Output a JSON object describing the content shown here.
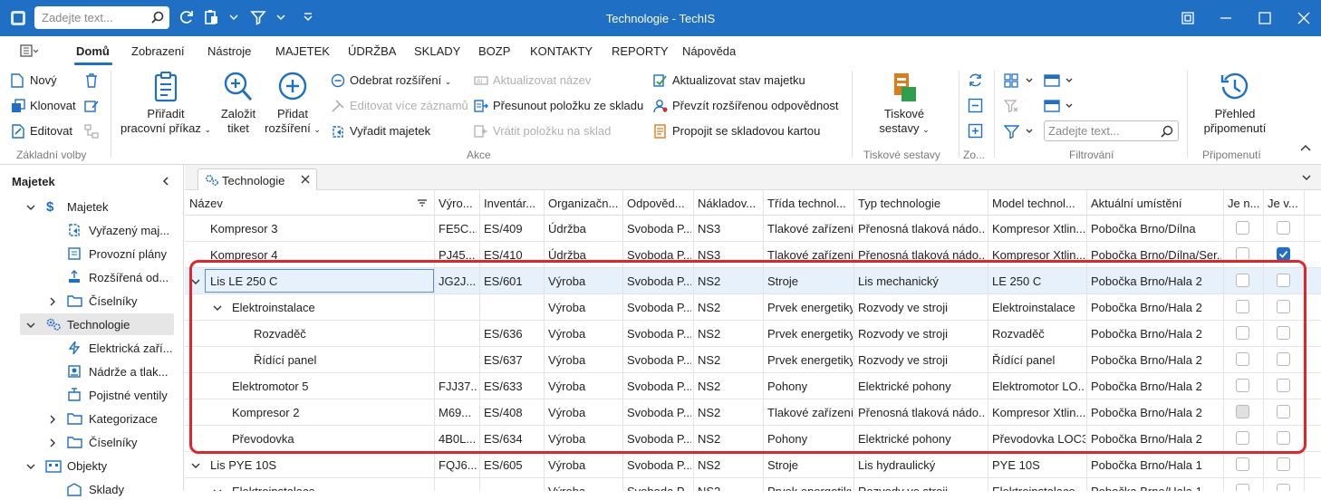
{
  "titlebar": {
    "title": "Technologie - TechIS",
    "search_placeholder": "Zadejte text...",
    "accent": "#1f6fc5"
  },
  "menu": {
    "items": [
      "Domů",
      "Zobrazení",
      "Nástroje",
      "MAJETEK",
      "ÚDRŽBA",
      "SKLADY",
      "BOZP",
      "KONTAKTY",
      "REPORTY",
      "Nápověda"
    ]
  },
  "ribbon": {
    "zakladni": {
      "novy": "Nový",
      "klonovat": "Klonovat",
      "editovat": "Editovat",
      "label": "Základní volby"
    },
    "akce": {
      "prirazeni_1": "Přiřadit",
      "prirazeni_2": "pracovní příkaz",
      "tiket_1": "Založit",
      "tiket_2": "tiket",
      "rozsireni_1": "Přidat",
      "rozsireni_2": "rozšíření",
      "odebrat": "Odebrat rozšíření",
      "editovat_vice": "Editovat více záznamů",
      "vyradit": "Vyřadit majetek",
      "aktualizovat_nazev": "Aktualizovat název",
      "presunout": "Přesunout položku ze skladu",
      "vratit": "Vrátit položku na sklad",
      "aktualizovat_stav": "Aktualizovat stav majetku",
      "prevzit": "Převzít rozšířenou odpovědnost",
      "propojit": "Propojit se skladovou kartou",
      "label": "Akce"
    },
    "tiskove": {
      "btn_1": "Tiskové",
      "btn_2": "sestavy",
      "label": "Tiskové sestavy"
    },
    "zo": {
      "label": "Zo..."
    },
    "filtrovani": {
      "placeholder": "Zadejte text...",
      "label": "Filtrování"
    },
    "pripomenuti": {
      "btn_1": "Přehled",
      "btn_2": "připomenutí",
      "label": "Připomenutí"
    }
  },
  "sidebar": {
    "title": "Majetek",
    "items": [
      {
        "label": "Majetek"
      },
      {
        "label": "Vyřazený maj..."
      },
      {
        "label": "Provozní plány"
      },
      {
        "label": "Rozšířená od..."
      },
      {
        "label": "Číselníky"
      },
      {
        "label": "Technologie"
      },
      {
        "label": "Elektrická zaří..."
      },
      {
        "label": "Nádrže a tlak..."
      },
      {
        "label": "Pojistné ventily"
      },
      {
        "label": "Kategorizace"
      },
      {
        "label": "Číselníky"
      },
      {
        "label": "Objekty"
      },
      {
        "label": "Sklady"
      }
    ]
  },
  "tab": {
    "label": "Technologie"
  },
  "table": {
    "columns": [
      "Název",
      "Výro...",
      "Inventár...",
      "Organizačn...",
      "Odpověd...",
      "Nákladov...",
      "Třída technol...",
      "Typ technologie",
      "Model technol...",
      "Aktuální umístění",
      "Je n...",
      "Je v..."
    ],
    "rows": [
      {
        "name": "Kompresor 3",
        "vyr": "FE5C...",
        "inv": "ES/409",
        "org": "Údržba",
        "odp": "Svoboda P...",
        "nak": "NS3",
        "trida": "Tlakové zařízení",
        "typ": "Přenosná tlaková nádo...",
        "model": "Kompresor Xtlin...",
        "umisteni": "Pobočka Brno/Dílna",
        "jen": false,
        "jev": false
      },
      {
        "name": "Kompresor 4",
        "vyr": "PJ45...",
        "inv": "ES/410",
        "org": "Údržba",
        "odp": "Svoboda P...",
        "nak": "NS3",
        "trida": "Tlakové zařízení",
        "typ": "Přenosná tlaková nádo...",
        "model": "Kompresor Xtlin...",
        "umisteni": "Pobočka Brno/Dílna/Ser...",
        "jen": false,
        "jev": true
      },
      {
        "name": "Lis LE 250 C",
        "vyr": "JG2J...",
        "inv": "ES/601",
        "org": "Výroba",
        "odp": "Svoboda P...",
        "nak": "NS2",
        "trida": "Stroje",
        "typ": "Lis mechanický",
        "model": "LE 250 C",
        "umisteni": "Pobočka Brno/Hala 2",
        "jen": false,
        "jev": false
      },
      {
        "name": "Elektroinstalace",
        "vyr": "",
        "inv": "",
        "org": "Výroba",
        "odp": "Svoboda P...",
        "nak": "NS2",
        "trida": "Prvek energetiky",
        "typ": "Rozvody ve stroji",
        "model": "Elektroinstalace",
        "umisteni": "Pobočka Brno/Hala 2",
        "jen": false,
        "jev": false
      },
      {
        "name": "Rozvaděč",
        "vyr": "",
        "inv": "ES/636",
        "org": "Výroba",
        "odp": "Svoboda P...",
        "nak": "NS2",
        "trida": "Prvek energetiky",
        "typ": "Rozvody ve stroji",
        "model": "Rozvaděč",
        "umisteni": "Pobočka Brno/Hala 2",
        "jen": false,
        "jev": false
      },
      {
        "name": "Řídící panel",
        "vyr": "",
        "inv": "ES/637",
        "org": "Výroba",
        "odp": "Svoboda P...",
        "nak": "NS2",
        "trida": "Prvek energetiky",
        "typ": "Rozvody ve stroji",
        "model": "Řídící panel",
        "umisteni": "Pobočka Brno/Hala 2",
        "jen": false,
        "jev": false
      },
      {
        "name": "Elektromotor 5",
        "vyr": "FJJ37...",
        "inv": "ES/633",
        "org": "Výroba",
        "odp": "Svoboda P...",
        "nak": "NS2",
        "trida": "Pohony",
        "typ": "Elektrické pohony",
        "model": "Elektromotor LO...",
        "umisteni": "Pobočka Brno/Hala 2",
        "jen": false,
        "jev": false
      },
      {
        "name": "Kompresor 2",
        "vyr": "M69...",
        "inv": "ES/408",
        "org": "Výroba",
        "odp": "Svoboda P...",
        "nak": "NS2",
        "trida": "Tlakové zařízení",
        "typ": "Přenosná tlaková nádo...",
        "model": "Kompresor Xtlin...",
        "umisteni": "Pobočka Brno/Hala 2",
        "jen": false,
        "jev": false
      },
      {
        "name": "Převodovka",
        "vyr": "4B0L...",
        "inv": "ES/634",
        "org": "Výroba",
        "odp": "Svoboda P...",
        "nak": "NS2",
        "trida": "Pohony",
        "typ": "Elektrické pohony",
        "model": "Převodovka LOC3...",
        "umisteni": "Pobočka Brno/Hala 2",
        "jen": false,
        "jev": false
      },
      {
        "name": "Lis PYE 10S",
        "vyr": "FQJ6...",
        "inv": "ES/605",
        "org": "Výroba",
        "odp": "Svoboda P...",
        "nak": "NS2",
        "trida": "Stroje",
        "typ": "Lis hydraulický",
        "model": "PYE 10S",
        "umisteni": "Pobočka Brno/Hala 1",
        "jen": false,
        "jev": false
      },
      {
        "name": "Elektroinstalace",
        "vyr": "",
        "inv": "",
        "org": "Výroba",
        "odp": "Svoboda P...",
        "nak": "NS2",
        "trida": "Prvek energetiky",
        "typ": "Rozvody ve stroji",
        "model": "Elektroinstalace",
        "umisteni": "Pobočka Brno/Hala 1",
        "jen": false,
        "jev": false
      }
    ]
  },
  "annotation": {
    "color": "#e0252c"
  }
}
